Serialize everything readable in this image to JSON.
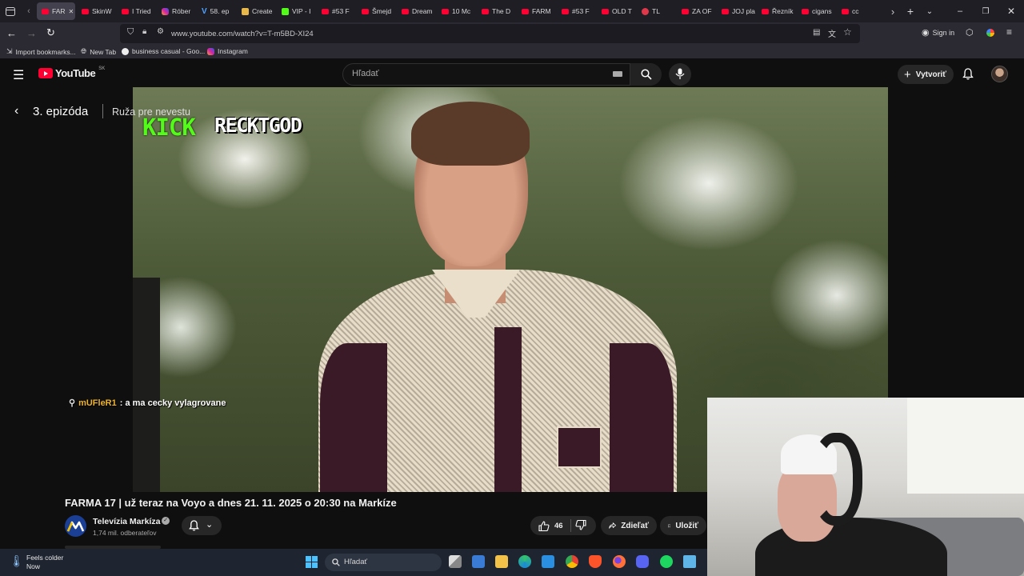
{
  "browser": {
    "tabs": [
      {
        "label": "FAR",
        "icon": "youtube-icon"
      },
      {
        "label": "SkinW",
        "icon": "youtube-icon"
      },
      {
        "label": "I Tried",
        "icon": "youtube-icon"
      },
      {
        "label": "Róber",
        "icon": "instagram-icon"
      },
      {
        "label": "58. ep",
        "icon": "v-icon"
      },
      {
        "label": "Create",
        "icon": "create-icon"
      },
      {
        "label": "VIP - I",
        "icon": "kick-icon"
      },
      {
        "label": "#53 F",
        "icon": "youtube-icon"
      },
      {
        "label": "Šmejd",
        "icon": "youtube-icon"
      },
      {
        "label": "Dream",
        "icon": "youtube-icon"
      },
      {
        "label": "10 Mc",
        "icon": "youtube-icon"
      },
      {
        "label": "The D",
        "icon": "youtube-icon"
      },
      {
        "label": "FARM",
        "icon": "youtube-icon"
      },
      {
        "label": "#53 F",
        "icon": "youtube-icon"
      },
      {
        "label": "OLD T",
        "icon": "youtube-icon"
      },
      {
        "label": "TL",
        "icon": "circle-icon"
      },
      {
        "label": "ZA OF",
        "icon": "youtube-icon"
      },
      {
        "label": "JOJ play",
        "icon": "youtube-icon"
      },
      {
        "label": "Řezník",
        "icon": "youtube-icon"
      },
      {
        "label": "cigans",
        "icon": "youtube-icon"
      },
      {
        "label": "cc",
        "icon": "youtube-icon"
      }
    ],
    "url": "www.youtube.com/watch?v=T-m5BD-XI24",
    "sign_in": "Sign in",
    "bookmarks": [
      "Import bookmarks...",
      "New Tab",
      "business casual - Goo...",
      "Instagram"
    ]
  },
  "youtube": {
    "logo_text": "YouTube",
    "region": "SK",
    "search_placeholder": "Hľadať",
    "create_label": "Vytvoriť"
  },
  "player": {
    "episode_title": "3. epizóda",
    "episode_subtitle": "Ruža pre nevestu",
    "kick_logo": "KICK",
    "kick_channel": "RECKTGOD",
    "chat_user": "mUFleR1",
    "chat_message": ": a ma cecky vylagrovane"
  },
  "video_info": {
    "title": "FARMA 17 | už teraz na Voyo a dnes 21. 11. 2025 o 20:30 na Markíze",
    "channel_name": "Televízia Markíza",
    "subscribers": "1,74 mil. odberateľov",
    "likes": "46",
    "share_label": "Zdieľať",
    "save_label": "Uložiť"
  },
  "taskbar": {
    "weather_line1": "Feels colder",
    "weather_line2": "Now",
    "search_label": "Hľadať"
  },
  "colors": {
    "youtube_red": "#ff0033",
    "kick_green": "#53fc18",
    "chat_user": "#f0b429"
  }
}
